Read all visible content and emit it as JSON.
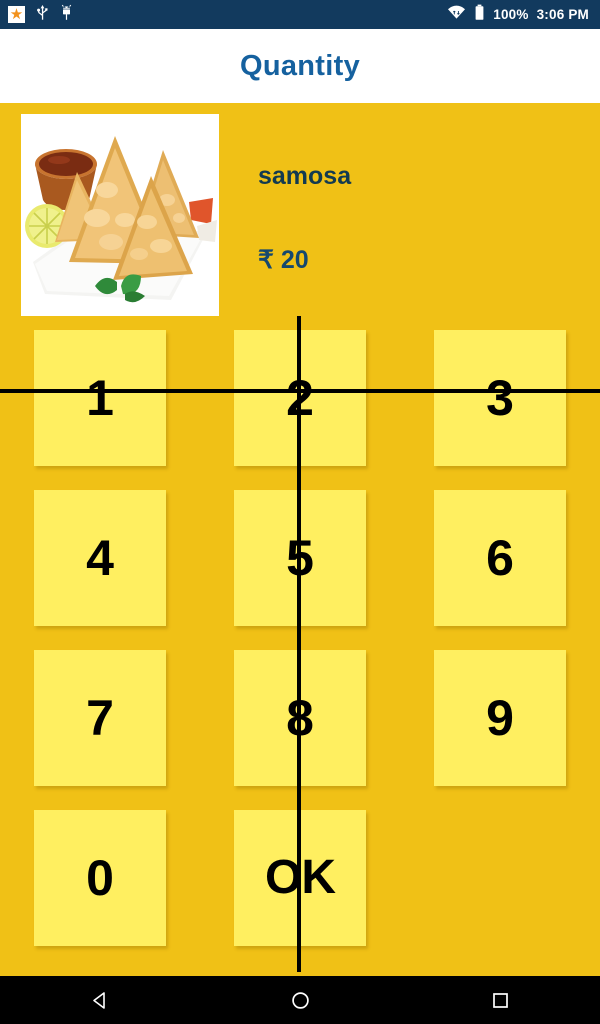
{
  "status_bar": {
    "background": "#123a5e",
    "left_icons": [
      {
        "name": "star-badge-icon",
        "glyph": "★"
      },
      {
        "name": "usb-icon",
        "glyph": "usb"
      },
      {
        "name": "android-debug-icon",
        "glyph": "android"
      }
    ],
    "right_icons": [
      {
        "name": "wifi-icon",
        "glyph": "wifi"
      },
      {
        "name": "battery-icon",
        "glyph": "battery"
      }
    ],
    "battery_level": "100%",
    "time": "3:06 PM"
  },
  "title_bar": {
    "title": "Quantity",
    "title_color": "#15619f",
    "background": "#ffffff"
  },
  "product": {
    "image_alt": "samosa-plate-photo",
    "name": "samosa",
    "price": "₹ 20",
    "name_color": "#123a50",
    "price_color": "#15486e"
  },
  "theme": {
    "screen_background": "#f0c116",
    "key_background": "#ffef60",
    "key_text_color": "#000000",
    "crosshair_color": "#000000"
  },
  "keypad": {
    "rows": [
      [
        {
          "name": "key-1",
          "label": "1"
        },
        {
          "name": "key-2",
          "label": "2"
        },
        {
          "name": "key-3",
          "label": "3"
        }
      ],
      [
        {
          "name": "key-4",
          "label": "4"
        },
        {
          "name": "key-5",
          "label": "5"
        },
        {
          "name": "key-6",
          "label": "6"
        }
      ],
      [
        {
          "name": "key-7",
          "label": "7"
        },
        {
          "name": "key-8",
          "label": "8"
        },
        {
          "name": "key-9",
          "label": "9"
        }
      ],
      [
        {
          "name": "key-0",
          "label": "0"
        },
        {
          "name": "key-ok",
          "label": "OK"
        },
        {
          "name": "key-empty",
          "label": ""
        }
      ]
    ]
  },
  "nav_bar": {
    "background": "#000000",
    "buttons": [
      {
        "name": "back-button-icon",
        "glyph": "triangle-left"
      },
      {
        "name": "home-button-icon",
        "glyph": "circle"
      },
      {
        "name": "recents-button-icon",
        "glyph": "square"
      }
    ]
  }
}
